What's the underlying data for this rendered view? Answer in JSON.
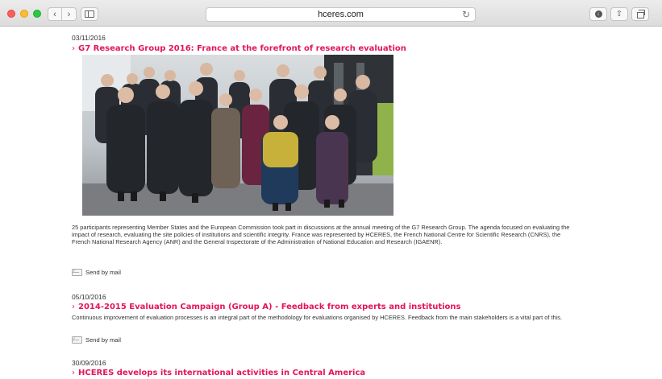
{
  "browser": {
    "url": "hceres.com",
    "reload_glyph": "↻",
    "back_glyph": "‹",
    "forward_glyph": "›",
    "share_glyph": "⇧",
    "download_glyph": "↓"
  },
  "articles": [
    {
      "date": "03/11/2016",
      "title": "G7 Research Group 2016: France at the forefront of research evaluation",
      "body": "25 participants representing Member States and the European Commission took part in discussions at the annual meeting of the G7 Research Group. The agenda focused on evaluating the impact of research, evaluating the site policies of institutions and scientific integrity. France was represented by HCERES, the French National Centre for Scientific Research (CNRS), the French National Research Agency (ANR) and the General Inspectorate of the Administration of National Education and Research (IGAENR).",
      "mail_label": "Send by mail"
    },
    {
      "date": "05/10/2016",
      "title": "2014-2015 Evaluation Campaign (Group A) - Feedback from experts and institutions",
      "body": "Continuous improvement of evaluation processes is an integral part of the methodology for evaluations organised by HCERES. Feedback from the main stakeholders is a vital part of this.",
      "mail_label": "Send by mail"
    },
    {
      "date": "30/09/2016",
      "title": "HCERES develops its international activities in Central America"
    }
  ],
  "colors": {
    "title": "#e3155b",
    "text": "#333333"
  },
  "title_prefix": "›"
}
